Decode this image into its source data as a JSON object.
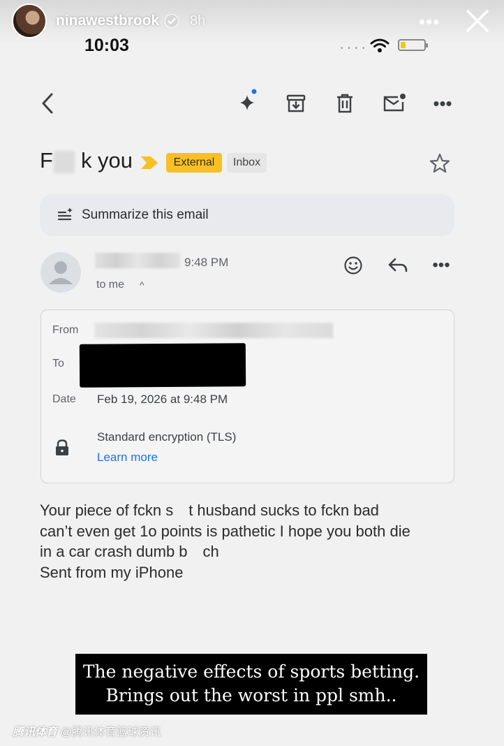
{
  "story": {
    "username": "ninawestbrook",
    "time_ago": "8h",
    "more_icon": "more-horizontal-icon",
    "close_icon": "close-icon"
  },
  "status_bar": {
    "time": "10:03",
    "signal": "• • • •",
    "battery_level": 0.2,
    "colors": {
      "battery": "#f2c811"
    }
  },
  "toolbar": {
    "more": "•••"
  },
  "email": {
    "subject_start": "F",
    "subject_end": "k you",
    "labels": {
      "external": "External",
      "inbox": "Inbox"
    },
    "summarize": "Summarize this email",
    "sender_time": "9:48 PM",
    "to_me": "to me",
    "to_caret": "^",
    "more": "•••",
    "details": {
      "from_label": "From",
      "to_label": "To",
      "date_label": "Date",
      "date_value": "Feb 19, 2026 at 9:48 PM",
      "encryption": "Standard encryption (TLS)",
      "learn_more": "Learn more"
    },
    "body": [
      "Your piece of fckn s t husband sucks to fckn bad",
      "can’t even get 1o points is pathetic I hope you both die",
      "in a car crash dumb b ch",
      "Sent from my iPhone"
    ]
  },
  "caption": {
    "line1": "The negative effects of sports betting.",
    "line2": "Brings out the worst in ppl smh.."
  },
  "watermark": {
    "brand": "腾讯体育",
    "handle": "@腾讯体育篮球资讯"
  },
  "colors": {
    "external_chip": "#f6c026",
    "link": "#1a73e8",
    "importance": "#f6c026"
  }
}
